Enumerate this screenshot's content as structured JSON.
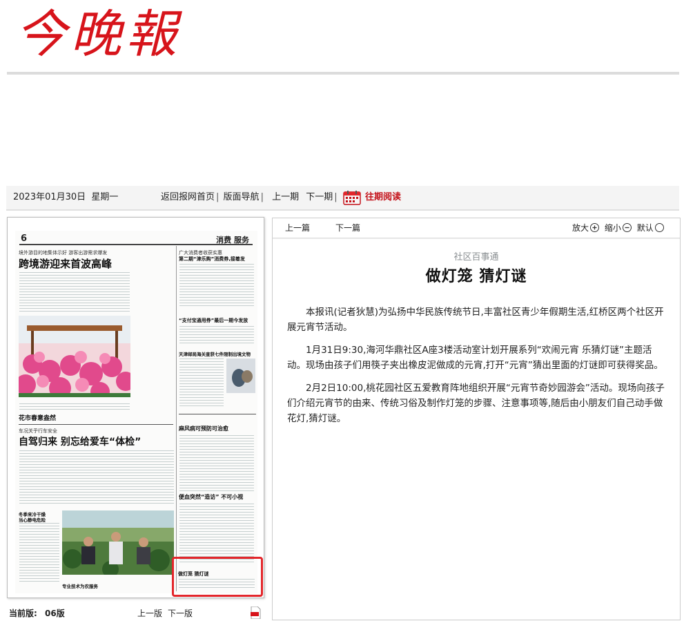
{
  "masthead": {
    "logo_text": "今晚報"
  },
  "datebar": {
    "date": "2023年01月30日",
    "weekday": "星期一",
    "nav_home": "返回报网首页",
    "nav_layout": "版面导航",
    "nav_prev": "上一期",
    "nav_next": "下一期",
    "archive": "往期阅读"
  },
  "page_preview": {
    "page_number": "6",
    "section": "消费 服务",
    "kicker1": "境外游目的地集体示好 游客出游需求爆发",
    "headline1": "跨境游迎来首波高峰",
    "photo_caption1": "花市春意盎然",
    "kicker2": "车况关乎行车安全",
    "headline2": "自驾归来 别忘给爱车“体检”",
    "side_kicker": "广大消费者收获实惠",
    "side_head1": "第二期“津乐购”消费券,接着发",
    "side_head2": "“支付宝通用券”最后一期今发放",
    "side_head3": "天津邮局海关查获七件限制出境文物",
    "side_head4": "麻风病可预防可治愈",
    "side_head5": "便血突然“造访” 不可小视",
    "side_head6": "做灯笼 猜灯谜",
    "small_head1": "冬季来冷干燥",
    "small_head2": "当心静电危险",
    "caption2": "专业技术为农服务"
  },
  "bottom": {
    "current_label": "当前版:",
    "current_value": "06版",
    "prev_page": "上一版",
    "next_page": "下一版"
  },
  "article_nav": {
    "prev": "上一篇",
    "next": "下一篇",
    "zoom_in": "放大",
    "zoom_out": "缩小",
    "default": "默认"
  },
  "article": {
    "kicker": "社区百事通",
    "title": "做灯笼 猜灯谜",
    "paragraphs": [
      "本报讯(记者狄慧)为弘扬中华民族传统节日,丰富社区青少年假期生活,红桥区两个社区开展元宵节活动。",
      "1月31日9:30,海河华鼎社区A座3楼活动室计划开展系列“欢闹元宵 乐猜灯谜”主题活动。现场由孩子们用筷子夹出橡皮泥做成的元宵,打开“元宵”猜出里面的灯谜即可获得奖品。",
      "2月2日10:00,桃花园社区五爱教育阵地组织开展“元宵节奇妙园游会”活动。现场向孩子们介绍元宵节的由来、传统习俗及制作灯笼的步骤、注意事项等,随后由小朋友们自己动手做花灯,猜灯谜。"
    ]
  },
  "colors": {
    "brand_red": "#d7141b",
    "highlight_red": "#e3262b",
    "kicker_gray": "#8a8f92"
  },
  "icons": [
    "calendar-icon",
    "zoom-in-icon",
    "zoom-out-icon",
    "zoom-default-icon",
    "pdf-icon"
  ]
}
